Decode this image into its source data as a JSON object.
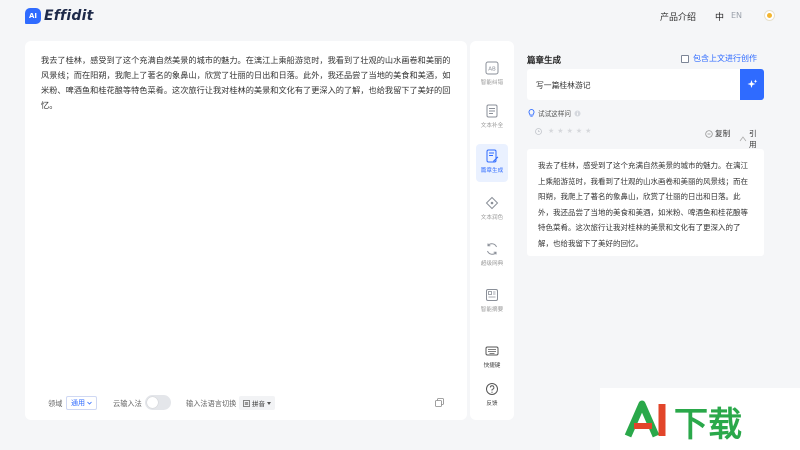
{
  "app": {
    "logo_badge": "AI",
    "logo_text": "Effidit"
  },
  "header": {
    "nav_product": "产品介绍",
    "lang_zh": "中",
    "lang_en": "EN",
    "theme_icon": "sun-icon"
  },
  "editor": {
    "content": "我去了桂林，感受到了这个充满自然美景的城市的魅力。在漓江上乘船游览时，我看到了壮观的山水画卷和美丽的风景线；而在阳朔，我爬上了著名的象鼻山，欣赏了壮丽的日出和日落。此外，我还品尝了当地的美食和美酒，如米粉、啤酒鱼和桂花酿等特色菜肴。这次旅行让我对桂林的美景和文化有了更深入的了解，也给我留下了美好的回忆。",
    "footer": {
      "domain_label": "领域",
      "domain_value": "通用",
      "cloud_ime_label": "云输入法",
      "ime_lang_label": "输入法语言切换",
      "ime_value": "拼音"
    }
  },
  "tools": [
    {
      "label": "智能纠错",
      "icon": "ab-correction-icon"
    },
    {
      "label": "文本补全",
      "icon": "document-icon"
    },
    {
      "label": "篇章生成",
      "icon": "edit-document-icon",
      "active": true
    },
    {
      "label": "文本润色",
      "icon": "polish-icon"
    },
    {
      "label": "超级网典",
      "icon": "refresh-book-icon"
    },
    {
      "label": "智能摘要",
      "icon": "summary-icon"
    },
    {
      "label": "快捷键",
      "icon": "keyboard-icon"
    },
    {
      "label": "反馈",
      "icon": "help-circle-icon"
    }
  ],
  "panel": {
    "title": "篇章生成",
    "context_checkbox_label": "包含上文进行创作",
    "prompt": "写一篇桂林游记",
    "try_label": "试试这样问",
    "copy_label": "复制",
    "quote_label": "引用",
    "stars": 5,
    "result": "我去了桂林，感受到了这个充满自然美景的城市的魅力。在漓江上乘船游览时，我看到了壮观的山水画卷和美丽的风景线；而在阳朔，我爬上了著名的象鼻山，欣赏了壮丽的日出和日落。此外，我还品尝了当地的美食和美酒，如米粉、啤酒鱼和桂花酿等特色菜肴。这次旅行让我对桂林的美景和文化有了更深入的了解，也给我留下了美好的回忆。"
  },
  "watermark": {
    "text": "AI下载"
  },
  "colors": {
    "accent": "#2f6bff",
    "background": "#f5f6f8",
    "watermark_green": "#2aa84a",
    "watermark_red": "#e2452a"
  }
}
